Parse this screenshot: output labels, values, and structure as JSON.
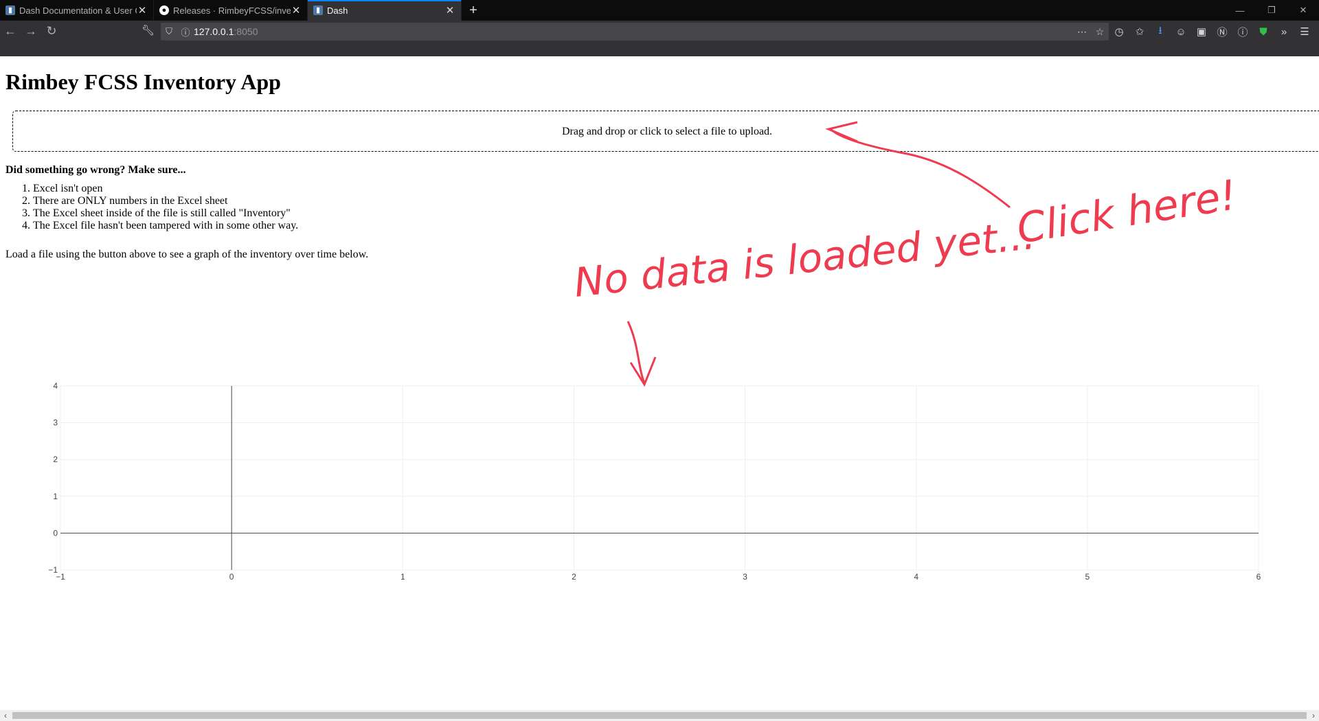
{
  "browser": {
    "tabs": [
      {
        "title": "Dash Documentation & User G",
        "favicon": "dash",
        "active": false
      },
      {
        "title": "Releases · RimbeyFCSS/invento",
        "favicon": "github",
        "active": false
      },
      {
        "title": "Dash",
        "favicon": "dash",
        "active": true
      }
    ],
    "url_host": "127.0.0.1",
    "url_port": ":8050",
    "icons": [
      "back-icon",
      "forward-icon",
      "reload-icon",
      "wrench-icon",
      "tracking-shield-icon",
      "info-icon",
      "more-icon",
      "bookmark-star-icon",
      "history-icon",
      "reading-list-icon",
      "download-icon",
      "account-icon",
      "extension-icon",
      "notion-icon",
      "onepassword-icon",
      "adblock-shield-icon",
      "overflow-icon",
      "menu-icon"
    ],
    "download_color": "#45a1ff",
    "accent": "#0a84ff"
  },
  "page": {
    "title": "Rimbey FCSS Inventory App",
    "upload_label": "Drag and drop or click to select a file to upload.",
    "warning_heading": "Did something go wrong? Make sure...",
    "checklist": [
      "Excel isn't open",
      "There are ONLY numbers in the Excel sheet",
      "The Excel sheet inside of the file is still called \"Inventory\"",
      "The Excel file hasn't been tampered with in some other way."
    ],
    "load_note": "Load a file using the button above to see a graph of the inventory over time below."
  },
  "annotations": {
    "text_no_data": "No data is loaded yet...",
    "text_click": "Click here!",
    "color": "#ee3b4f"
  },
  "chart_data": {
    "type": "line",
    "series": [],
    "xlim": [
      -1,
      6
    ],
    "ylim": [
      -1,
      4
    ],
    "xticks": [
      "−1",
      "0",
      "1",
      "2",
      "3",
      "4",
      "5",
      "6"
    ],
    "yticks": [
      "−1",
      "0",
      "1",
      "2",
      "3",
      "4"
    ],
    "grid": true,
    "title": "",
    "xlabel": "",
    "ylabel": ""
  }
}
